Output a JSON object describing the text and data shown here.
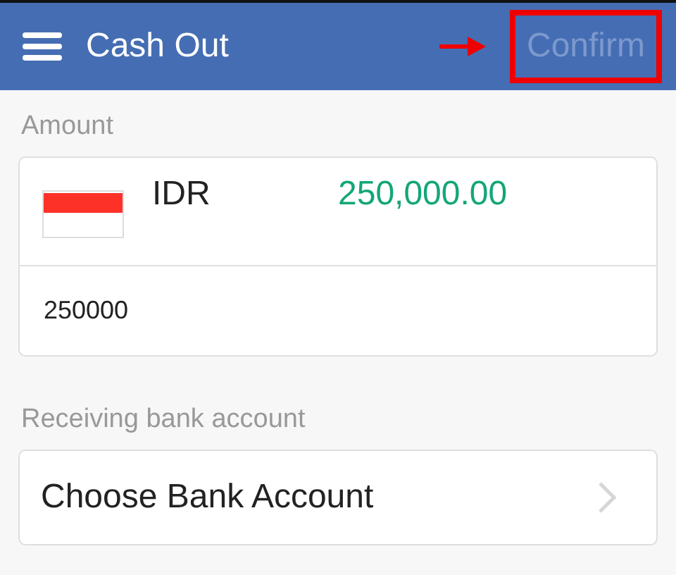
{
  "header": {
    "title": "Cash Out",
    "confirm": {
      "label": "Confirm",
      "disabled": true,
      "annotated": true
    }
  },
  "amount": {
    "label": "Amount",
    "currency": "IDR",
    "converted": "250,000.00",
    "value": "250000"
  },
  "bank": {
    "label": "Receiving bank account",
    "choice": "Choose Bank Account"
  }
}
